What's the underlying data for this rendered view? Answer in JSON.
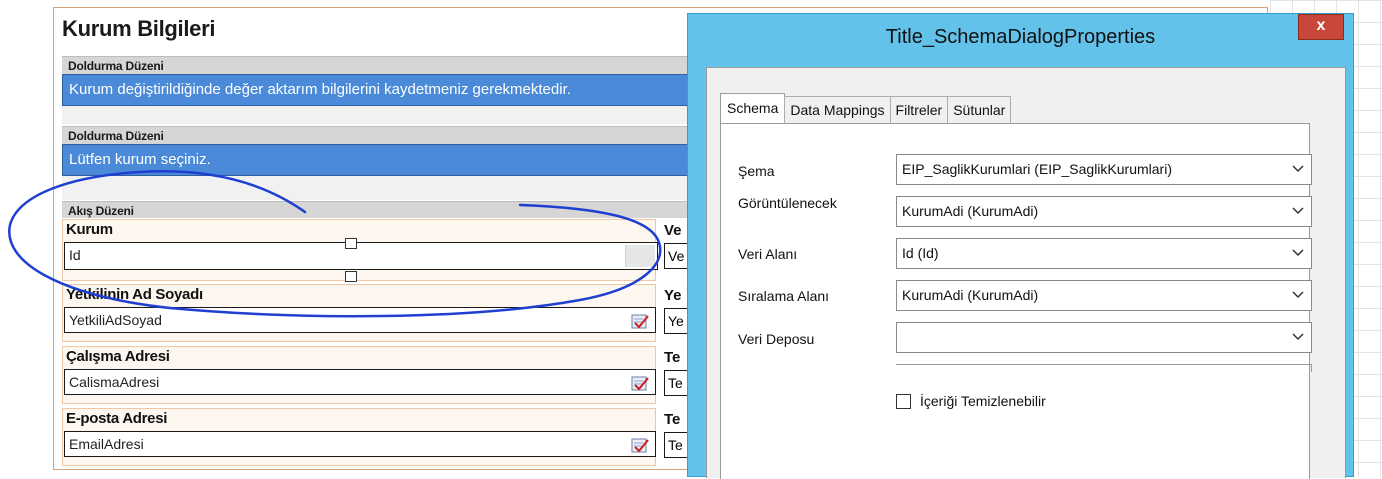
{
  "form": {
    "title": "Kurum Bilgileri",
    "sections": [
      {
        "header": "Doldurma Düzeni",
        "info": "Kurum değiştirildiğinde değer aktarım bilgilerini kaydetmeniz gerekmektedir."
      },
      {
        "header": "Doldurma Düzeni",
        "info": "Lütfen kurum seçiniz."
      }
    ],
    "flow_header": "Akış Düzeni",
    "fields": [
      {
        "label": "Kurum",
        "value": "Id"
      },
      {
        "label": "Yetkilinin Ad Soyadı",
        "value": "YetkiliAdSoyad"
      },
      {
        "label": "Çalışma Adresi",
        "value": "CalismaAdresi"
      },
      {
        "label": "E-posta Adresi",
        "value": "EmailAdresi"
      }
    ],
    "right_col": [
      {
        "label": "Ve",
        "value": "Ve"
      },
      {
        "label": "Ye",
        "value": "Ye"
      },
      {
        "label": "Te",
        "value": "Te"
      },
      {
        "label": "Te",
        "value": "Te"
      }
    ]
  },
  "dialog": {
    "title": "Title_SchemaDialogProperties",
    "close_label": "x",
    "tabs": [
      "Schema",
      "Data Mappings",
      "Filtreler",
      "Sütunlar"
    ],
    "active_tab": "Schema",
    "properties": [
      {
        "label": "Şema",
        "value": "EIP_SaglikKurumlari (EIP_SaglikKurumlari)"
      },
      {
        "label": "Görüntülenecek",
        "value": "KurumAdi (KurumAdi)"
      },
      {
        "label": "Veri Alanı",
        "value": "Id (Id)"
      },
      {
        "label": "Sıralama Alanı",
        "value": "KurumAdi (KurumAdi)"
      },
      {
        "label": "Veri Deposu",
        "value": ""
      }
    ],
    "checkbox_label": "İçeriği Temizlenebilir",
    "checkbox_checked": false
  },
  "colors": {
    "info_bar": "#4a8ad8",
    "dialog_frame": "#63c2ea",
    "close_button": "#c7473a",
    "annotation": "#1f3fd1"
  },
  "icons": [
    "edit-check-icon",
    "chevron-down-icon",
    "close-icon"
  ]
}
